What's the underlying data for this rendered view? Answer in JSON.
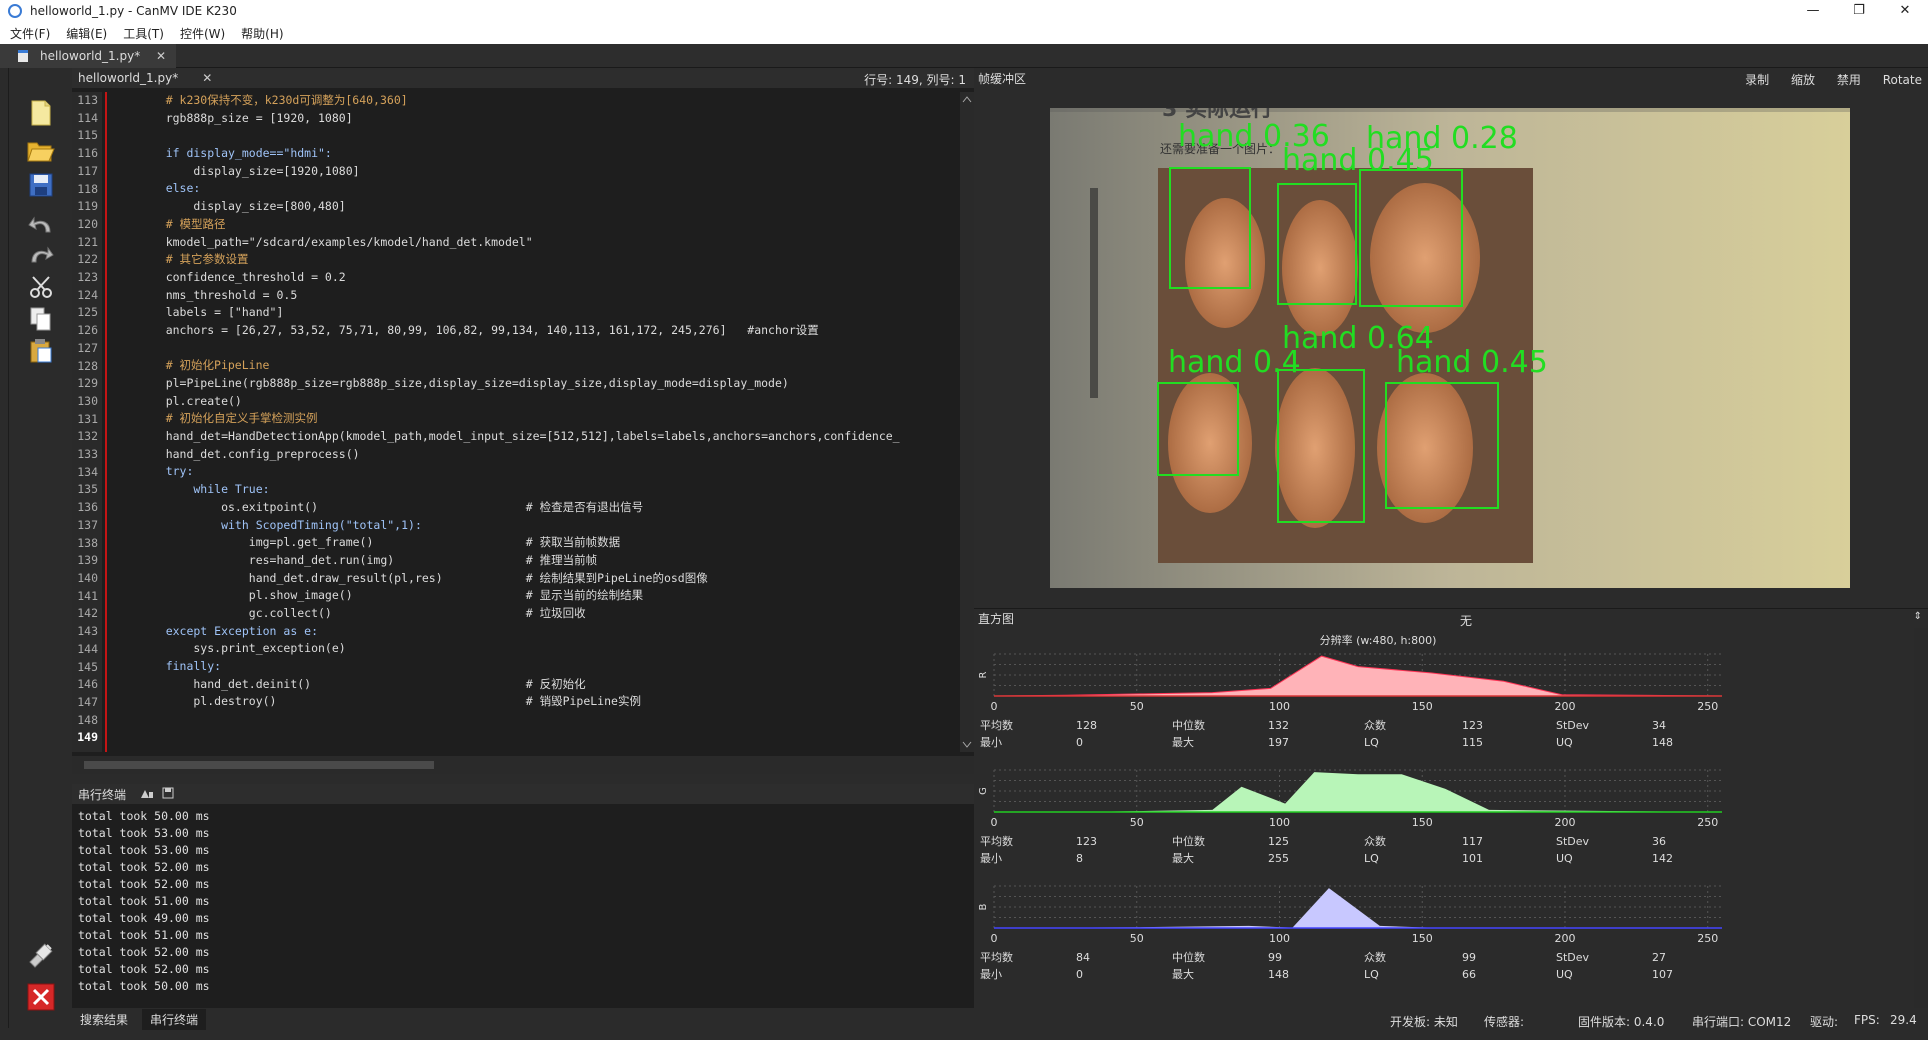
{
  "window": {
    "title": "helloworld_1.py - CanMV IDE K230",
    "minimize": "—",
    "restore": "❐",
    "close": "✕"
  },
  "menu": [
    "文件(F)",
    "编辑(E)",
    "工具(T)",
    "控件(W)",
    "帮助(H)"
  ],
  "file_tab": {
    "label": "helloworld_1.py*",
    "close": "✕"
  },
  "editor": {
    "file_label": "helloworld_1.py*",
    "position": "行号: 149, 列号: 1",
    "line_numbers": [
      "113",
      "114",
      "115",
      "116",
      "117",
      "118",
      "119",
      "120",
      "121",
      "122",
      "123",
      "124",
      "125",
      "126",
      "127",
      "128",
      "129",
      "130",
      "131",
      "132",
      "133",
      "134",
      "135",
      "136",
      "137",
      "138",
      "139",
      "140",
      "141",
      "142",
      "143",
      "144",
      "145",
      "146",
      "147",
      "148",
      "149"
    ],
    "code": [
      "    # k230保持不变，k230d可调整为[640,360]",
      "    rgb888p_size = [1920, 1080]",
      "",
      "    if display_mode==\"hdmi\":",
      "        display_size=[1920,1080]",
      "    else:",
      "        display_size=[800,480]",
      "    # 模型路径",
      "    kmodel_path=\"/sdcard/examples/kmodel/hand_det.kmodel\"",
      "    # 其它参数设置",
      "    confidence_threshold = 0.2",
      "    nms_threshold = 0.5",
      "    labels = [\"hand\"]",
      "    anchors = [26,27, 53,52, 75,71, 80,99, 106,82, 99,134, 140,113, 161,172, 245,276]   #anchor设置",
      "",
      "    # 初始化PipeLine",
      "    pl=PipeLine(rgb888p_size=rgb888p_size,display_size=display_size,display_mode=display_mode)",
      "    pl.create()",
      "    # 初始化自定义手掌检测实例",
      "    hand_det=HandDetectionApp(kmodel_path,model_input_size=[512,512],labels=labels,anchors=anchors,confidence_",
      "    hand_det.config_preprocess()",
      "    try:",
      "        while True:",
      "            os.exitpoint()                              # 检查是否有退出信号",
      "            with ScopedTiming(\"total\",1):",
      "                img=pl.get_frame()                      # 获取当前帧数据",
      "                res=hand_det.run(img)                   # 推理当前帧",
      "                hand_det.draw_result(pl,res)            # 绘制结果到PipeLine的osd图像",
      "                pl.show_image()                         # 显示当前的绘制结果",
      "                gc.collect()                            # 垃圾回收",
      "    except Exception as e:",
      "        sys.print_exception(e)",
      "    finally:",
      "        hand_det.deinit()                               # 反初始化",
      "        pl.destroy()                                    # 销毁PipeLine实例",
      "",
      ""
    ]
  },
  "serial": {
    "title": "串行终端",
    "lines": [
      "total took 50.00 ms",
      "total took 53.00 ms",
      "total took 53.00 ms",
      "total took 52.00 ms",
      "total took 52.00 ms",
      "total took 51.00 ms",
      "total took 49.00 ms",
      "total took 51.00 ms",
      "total took 52.00 ms",
      "total took 52.00 ms",
      "total took 50.00 ms"
    ]
  },
  "bottom_tabs": [
    "搜索结果",
    "串行终端"
  ],
  "framebuffer": {
    "title": "帧缓冲区",
    "buttons": [
      "录制",
      "缩放",
      "禁用",
      "Rotate"
    ],
    "photo_heading": "3 实际运行",
    "photo_subtext": "还需要准备一个图片：",
    "detections": [
      {
        "label": "hand 0.36"
      },
      {
        "label": "hand 0.45"
      },
      {
        "label": "hand 0.28"
      },
      {
        "label": "hand 0.64"
      },
      {
        "label": "hand 0.4"
      },
      {
        "label": "hand 0.45"
      }
    ]
  },
  "histogram": {
    "title": "直方图",
    "mode": "无",
    "resolution": "分辨率 (w:480, h:800)",
    "tick_labels": [
      "0",
      "50",
      "100",
      "150",
      "200",
      "250"
    ],
    "channels": [
      {
        "name": "R",
        "color": "#ffb3b8",
        "stats": {
          "平均数": "128",
          "中位数": "132",
          "众数": "123",
          "StDev": "34",
          "最小": "0",
          "最大": "197",
          "LQ": "115",
          "UQ": "148"
        }
      },
      {
        "name": "G",
        "color": "#b8f5b8",
        "stats": {
          "平均数": "123",
          "中位数": "125",
          "众数": "117",
          "StDev": "36",
          "最小": "8",
          "最大": "255",
          "LQ": "101",
          "UQ": "142"
        }
      },
      {
        "name": "B",
        "color": "#c8c8ff",
        "stats": {
          "平均数": "84",
          "中位数": "99",
          "众数": "99",
          "StDev": "27",
          "最小": "0",
          "最大": "148",
          "LQ": "66",
          "UQ": "107"
        }
      }
    ]
  },
  "status": {
    "board": "开发板: 未知",
    "sensor": "传感器:",
    "firmware": "固件版本: 0.4.0",
    "port": "串行端口: COM12",
    "driver": "驱动:",
    "fps": "FPS:",
    "fps_value": "29.4"
  }
}
